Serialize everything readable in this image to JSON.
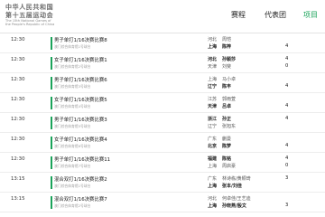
{
  "header": {
    "logo_line1": "中华人民共和国",
    "logo_line2": "第十五届运动会",
    "logo_line3a": "The 15th National Games of",
    "logo_line3b": "the People's Republic of China",
    "nav": [
      "赛程",
      "代表团",
      "项目"
    ],
    "nav_active_index": 2
  },
  "matches": [
    {
      "time": "12:30",
      "title": "男子单打1/16决赛比赛8",
      "venue": "澳门综合体育馆1号球台",
      "t1_prov": "河北",
      "t1_name": "周恺",
      "t2_prov": "上海",
      "t2_name": "陈梓",
      "s1": "",
      "s2": "4",
      "winner": 2
    },
    {
      "time": "12:30",
      "title": "女子单打1/16决赛比赛1",
      "venue": "澳门综合体育馆2号球台",
      "t1_prov": "河北",
      "t1_name": "孙颖莎",
      "t2_prov": "天津",
      "t2_name": "刘斐",
      "s1": "4",
      "s2": "0",
      "winner": 1
    },
    {
      "time": "12:30",
      "title": "男子单打1/16决赛比赛6",
      "venue": "澳门综合体育馆3号球台",
      "t1_prov": "上海",
      "t1_name": "马小卓",
      "t2_prov": "辽宁",
      "t2_name": "陈丰",
      "s1": "",
      "s2": "4",
      "winner": 2
    },
    {
      "time": "12:30",
      "title": "女子单打1/16决赛比赛5",
      "venue": "澳门综合体育馆4号球台",
      "t1_prov": "江苏",
      "t1_name": "郭雨萱",
      "t2_prov": "天津",
      "t2_name": "吕卓",
      "s1": "",
      "s2": "4",
      "winner": 2
    },
    {
      "time": "12:30",
      "title": "男子单打1/16决赛比赛3",
      "venue": "澳门综合体育馆5号球台",
      "t1_prov": "浙江",
      "t1_name": "孙正",
      "t2_prov": "辽宁",
      "t2_name": "张旭东",
      "s1": "4",
      "s2": "",
      "winner": 1
    },
    {
      "time": "12:30",
      "title": "女子单打1/16决赛比赛4",
      "venue": "澳门综合体育馆6号球台",
      "t1_prov": "广东",
      "t1_name": "蒯曼",
      "t2_prov": "北京",
      "t2_name": "陈梦",
      "s1": "",
      "s2": "4",
      "winner": 2
    },
    {
      "time": "12:30",
      "title": "男子单打1/16决赛比赛11",
      "venue": "澳门综合体育馆7号球台",
      "t1_prov": "福建",
      "t1_name": "陈铭",
      "t2_prov": "上海",
      "t2_name": "周启豪",
      "s1": "4",
      "s2": "0",
      "winner": 1
    },
    {
      "time": "13:15",
      "title": "混合双打1/16决赛比赛2",
      "venue": "澳门综合体育馆1号球台",
      "t1_prov": "广东",
      "t1_name": "林诗栋/黄颖琦",
      "t2_prov": "上海",
      "t2_name": "张本/刘佳",
      "s1": "3",
      "s2": "",
      "winner": 2
    },
    {
      "time": "13:15",
      "title": "混合双打1/16决赛比赛7",
      "venue": "澳门综合体育馆2号球台",
      "t1_prov": "河北",
      "t1_name": "何卓佳/王艺迪",
      "t2_prov": "上海",
      "t2_name": "孙晓燕/殷文",
      "s1": "",
      "s2": "3",
      "winner": 2
    }
  ]
}
